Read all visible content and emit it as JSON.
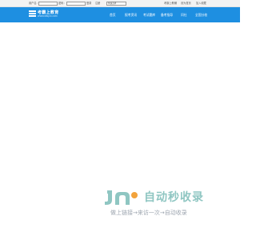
{
  "topbar": {
    "username_label": "用户名：",
    "password_label": "密码：",
    "login_label": "登录",
    "register_label": "注册",
    "select_value": "快速选择",
    "links": [
      "考霸上教辅",
      "设为首页",
      "加入收藏"
    ]
  },
  "logo": {
    "title": "考霸上教育",
    "subtitle": "WWW.KBSJXX.COM"
  },
  "nav": {
    "items": [
      "首页",
      "报考资讯",
      "考试题库",
      "备考指导",
      "问社",
      "全国分校"
    ]
  },
  "watermark": {
    "title": "自动秒收录",
    "subtitle": "做上链接→来访一次→自动收录"
  },
  "colors": {
    "navbar": "#1e8fe1",
    "watermark_green": "#8fc6c2",
    "watermark_orange": "#f2a33c"
  }
}
